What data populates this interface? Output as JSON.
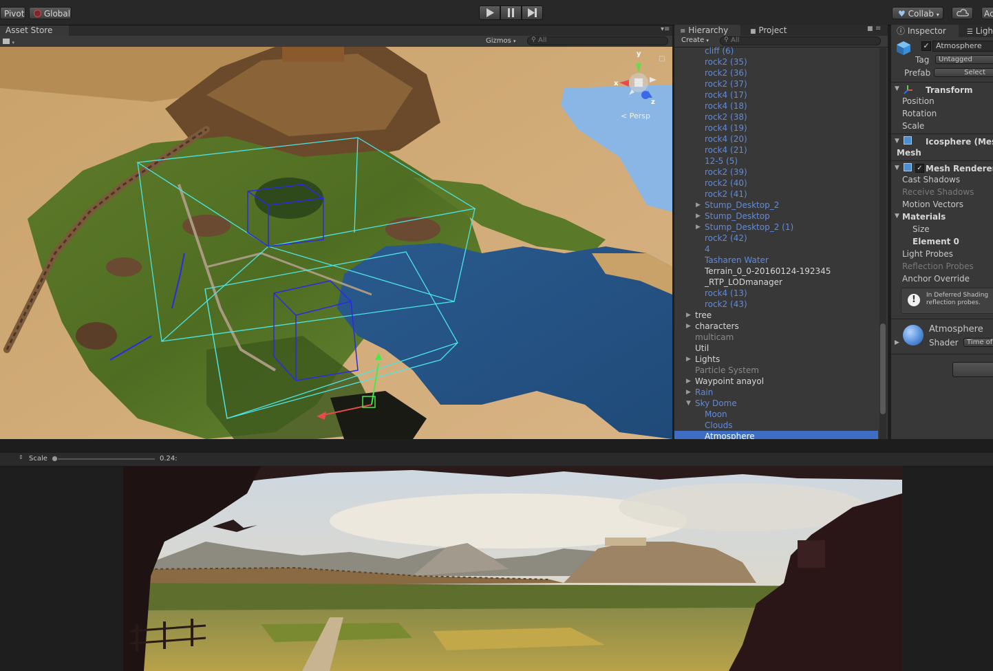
{
  "toolbar": {
    "pivot_label": "Pivot",
    "global_label": "Global",
    "play_icon": "play-icon",
    "pause_icon": "pause-icon",
    "step_icon": "step-icon",
    "collab_label": "Collab",
    "account_label": "Ac"
  },
  "scene_panel": {
    "tab_label": "Asset Store",
    "gizmos_label": "Gizmos",
    "search_placeholder": "All",
    "persp_label": "Persp",
    "axis_y": "y",
    "axis_x": "x",
    "axis_z": "z"
  },
  "hierarchy": {
    "tab_label": "Hierarchy",
    "project_tab_label": "Project",
    "create_label": "Create",
    "search_placeholder": "All",
    "rows": [
      {
        "label": "cliff (6)",
        "style": "blue",
        "indent": 1
      },
      {
        "label": "rock2 (35)",
        "style": "blue",
        "indent": 1
      },
      {
        "label": "rock2 (36)",
        "style": "blue",
        "indent": 1
      },
      {
        "label": "rock2 (37)",
        "style": "blue",
        "indent": 1
      },
      {
        "label": "rock4 (17)",
        "style": "blue",
        "indent": 1
      },
      {
        "label": "rock4 (18)",
        "style": "blue",
        "indent": 1
      },
      {
        "label": "rock2 (38)",
        "style": "blue",
        "indent": 1
      },
      {
        "label": "rock4 (19)",
        "style": "blue",
        "indent": 1
      },
      {
        "label": "rock4 (20)",
        "style": "blue",
        "indent": 1
      },
      {
        "label": "rock4 (21)",
        "style": "blue",
        "indent": 1
      },
      {
        "label": "12-5 (5)",
        "style": "blue",
        "indent": 1
      },
      {
        "label": "rock2 (39)",
        "style": "blue",
        "indent": 1
      },
      {
        "label": "rock2 (40)",
        "style": "blue",
        "indent": 1
      },
      {
        "label": "rock2 (41)",
        "style": "blue",
        "indent": 1
      },
      {
        "label": "Stump_Desktop_2",
        "style": "blue",
        "indent": 1,
        "arrow": "right"
      },
      {
        "label": "Stump_Desktop",
        "style": "blue",
        "indent": 1,
        "arrow": "right"
      },
      {
        "label": "Stump_Desktop_2 (1)",
        "style": "blue",
        "indent": 1,
        "arrow": "right"
      },
      {
        "label": "rock2 (42)",
        "style": "blue",
        "indent": 1
      },
      {
        "label": "4",
        "style": "blue",
        "indent": 1
      },
      {
        "label": "Tasharen Water",
        "style": "blue",
        "indent": 1
      },
      {
        "label": "Terrain_0_0-20160124-192345",
        "style": "white",
        "indent": 1
      },
      {
        "label": "_RTP_LODmanager",
        "style": "white",
        "indent": 1
      },
      {
        "label": "rock4 (13)",
        "style": "blue",
        "indent": 1
      },
      {
        "label": "rock2 (43)",
        "style": "blue",
        "indent": 1
      },
      {
        "label": "tree",
        "style": "white",
        "indent": 0,
        "arrow": "right"
      },
      {
        "label": "characters",
        "style": "white",
        "indent": 0,
        "arrow": "right"
      },
      {
        "label": "multicam",
        "style": "dark",
        "indent": 0
      },
      {
        "label": "Util",
        "style": "white",
        "indent": 0
      },
      {
        "label": "Lights",
        "style": "white",
        "indent": 0,
        "arrow": "right"
      },
      {
        "label": "Particle System",
        "style": "dark",
        "indent": 0
      },
      {
        "label": "Waypoint anayol",
        "style": "white",
        "indent": 0,
        "arrow": "right"
      },
      {
        "label": "Rain",
        "style": "blue",
        "indent": 0,
        "arrow": "right"
      },
      {
        "label": "Sky Dome",
        "style": "blue",
        "indent": 0,
        "arrow": "down"
      },
      {
        "label": "Moon",
        "style": "blue",
        "indent": 1
      },
      {
        "label": "Clouds",
        "style": "blue",
        "indent": 1
      },
      {
        "label": "Atmosphere",
        "style": "white",
        "indent": 1,
        "selected": true
      }
    ]
  },
  "inspector": {
    "tab_label": "Inspector",
    "lighting_tab_label": "Ligh",
    "object_name": "Atmosphere",
    "tag_label": "Tag",
    "tag_value": "Untagged",
    "prefab_label": "Prefab",
    "prefab_select": "Select",
    "transform_title": "Transform",
    "position_label": "Position",
    "rotation_label": "Rotation",
    "scale_label": "Scale",
    "mesh_filter_title": "Icosphere (Mes",
    "mesh_label": "Mesh",
    "mesh_renderer_title": "Mesh Renderer",
    "cast_shadows_label": "Cast Shadows",
    "receive_shadows_label": "Receive Shadows",
    "motion_vectors_label": "Motion Vectors",
    "materials_label": "Materials",
    "size_label": "Size",
    "element0_label": "Element 0",
    "light_probes_label": "Light Probes",
    "reflection_probes_label": "Reflection Probes",
    "anchor_override_label": "Anchor Override",
    "info_line1": "In Deferred Shading",
    "info_line2": "reflection probes.",
    "material_name": "Atmosphere",
    "shader_label": "Shader",
    "shader_value": "Time of"
  },
  "game_panel": {
    "scale_label": "Scale",
    "scale_value": "0.24:",
    "scale_slider_value": 0.0
  },
  "colors": {
    "hierarchy_blue": "#5c8de4",
    "selection_blue": "#3d6ec2",
    "panel_bg": "#383838",
    "toolbar_bg": "#282828"
  }
}
